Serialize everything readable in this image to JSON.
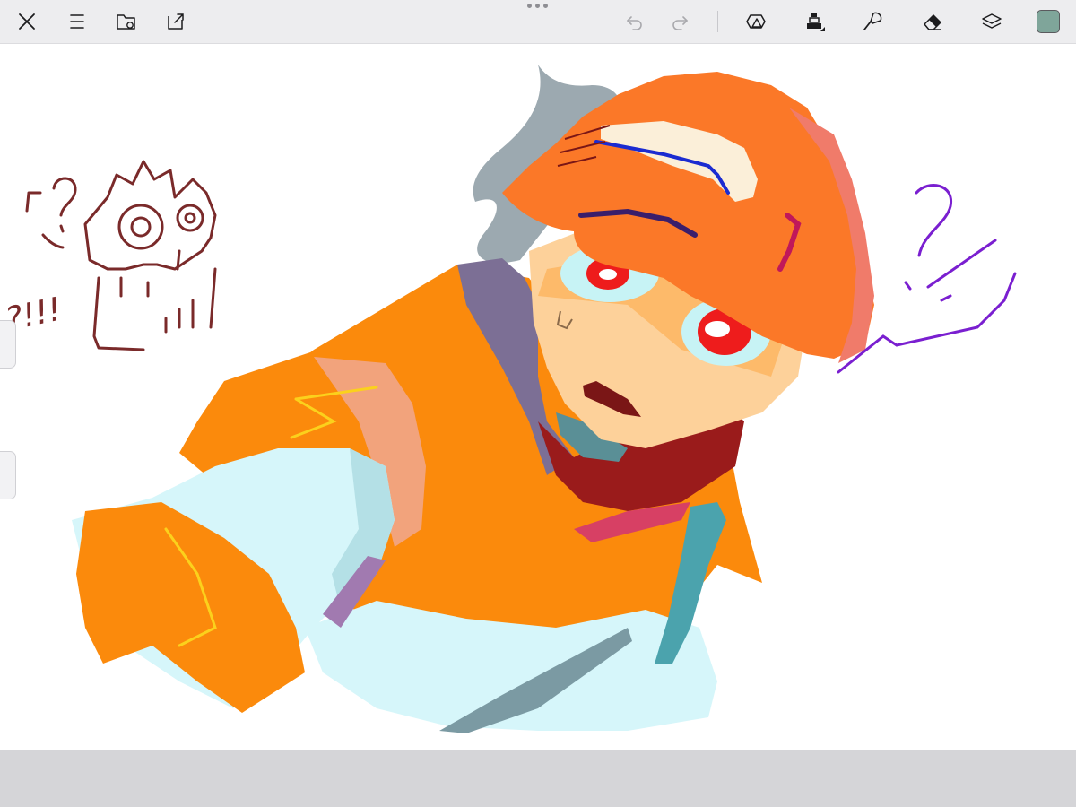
{
  "toolbar": {
    "close_icon": "close-icon",
    "menu_icon": "menu-icon",
    "gallery_icon": "gallery-folder-icon",
    "share_icon": "share-icon",
    "undo_icon": "undo-icon",
    "redo_icon": "redo-icon",
    "shapes_icon": "shapes-icon",
    "brush_icon": "brush-tool-icon",
    "smudge_icon": "smudge-tool-icon",
    "eraser_icon": "eraser-icon",
    "layers_icon": "layers-icon"
  },
  "colors": {
    "current_color": "#7fa59a",
    "toolbar_bg": "#ededef",
    "canvas_bg": "#ffffff"
  },
  "canvas": {
    "doodle_left_text": "?!!!"
  }
}
